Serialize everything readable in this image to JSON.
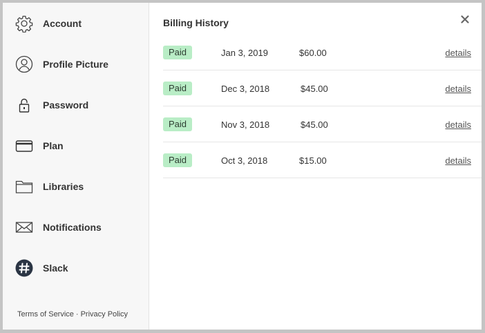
{
  "sidebar": {
    "items": [
      {
        "label": "Account",
        "icon": "gear-icon"
      },
      {
        "label": "Profile Picture",
        "icon": "user-circle-icon"
      },
      {
        "label": "Password",
        "icon": "padlock-icon"
      },
      {
        "label": "Plan",
        "icon": "credit-card-icon"
      },
      {
        "label": "Libraries",
        "icon": "folder-icon"
      },
      {
        "label": "Notifications",
        "icon": "envelope-icon"
      },
      {
        "label": "Slack",
        "icon": "slack-hash-icon"
      }
    ],
    "footer": {
      "terms": "Terms of Service",
      "separator": "·",
      "privacy": "Privacy Policy"
    }
  },
  "main": {
    "title": "Billing History",
    "close_icon": "close-icon",
    "rows": [
      {
        "status": "Paid",
        "date": "Jan 3, 2019",
        "amount": "$60.00",
        "link": "details"
      },
      {
        "status": "Paid",
        "date": "Dec 3, 2018",
        "amount": "$45.00",
        "link": "details"
      },
      {
        "status": "Paid",
        "date": "Nov 3, 2018",
        "amount": "$45.00",
        "link": "details"
      },
      {
        "status": "Paid",
        "date": "Oct 3, 2018",
        "amount": "$15.00",
        "link": "details"
      }
    ]
  },
  "colors": {
    "sidebar_bg": "#f7f7f7",
    "badge_bg": "#b9edc6",
    "text": "#333333"
  }
}
